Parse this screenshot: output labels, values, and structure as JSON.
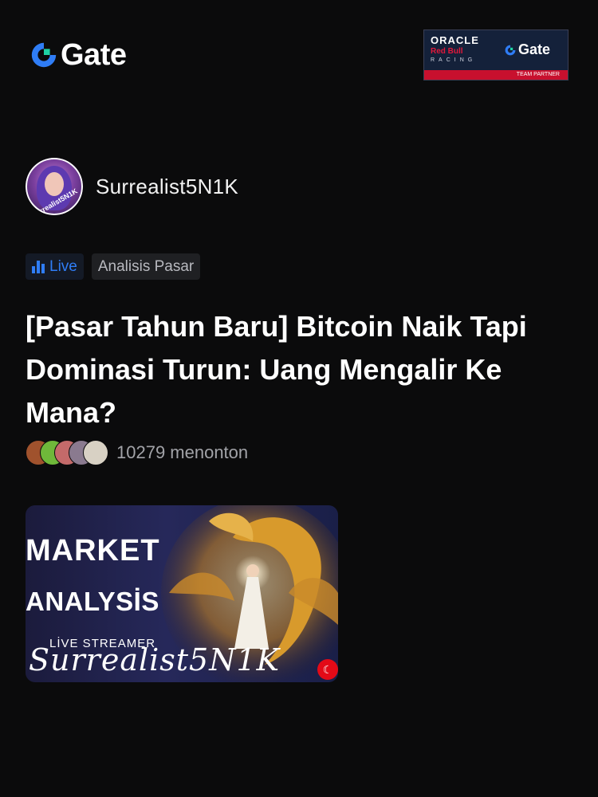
{
  "brand": {
    "name": "Gate",
    "logo_icon": "gate-logo-icon"
  },
  "partner_badge": {
    "line1": "ORACLE",
    "line2": "Red Bull",
    "line3": "RACING",
    "gate": "Gate",
    "strip": "TEAM PARTNER"
  },
  "author": {
    "name": "Surrealist5N1K",
    "avatar_text": "Surrealist5N1K"
  },
  "tags": [
    {
      "label": "Live",
      "icon": "live-bars-icon"
    },
    {
      "label": "Analisis Pasar"
    }
  ],
  "post": {
    "title": "[Pasar Tahun Baru] Bitcoin Naik Tapi Dominasi Turun: Uang Mengalir Ke Mana?"
  },
  "viewers": {
    "count_text": "10279 menonton"
  },
  "thumbnail": {
    "line1": "MARKET",
    "line2": "ANALYSİS",
    "caption": "LİVE STREAMER",
    "script": "Surrealist5N1K",
    "flag": "turkey-flag-icon"
  },
  "colors": {
    "background": "#0b0b0c",
    "accent": "#2f7df6",
    "partner_red": "#c8102e"
  }
}
